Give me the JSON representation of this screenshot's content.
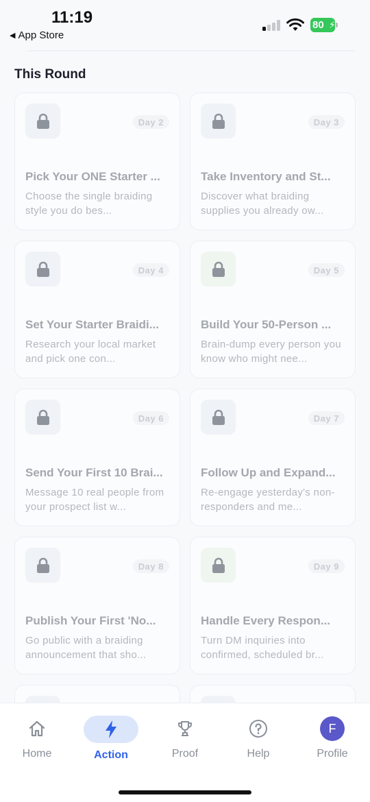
{
  "status_bar": {
    "time": "11:19",
    "back_label": "App Store",
    "battery": "80"
  },
  "section": {
    "title": "This Round"
  },
  "cards": [
    {
      "day": "Day 2",
      "title": "Pick Your ONE Starter ...",
      "desc": "Choose the single braiding style you do bes...",
      "lock_color": "blue"
    },
    {
      "day": "Day 3",
      "title": "Take Inventory and St...",
      "desc": "Discover what braiding supplies you already ow...",
      "lock_color": "blue"
    },
    {
      "day": "Day 4",
      "title": "Set Your Starter Braidi...",
      "desc": "Research your local market and pick one con...",
      "lock_color": "blue"
    },
    {
      "day": "Day 5",
      "title": "Build Your 50-Person ...",
      "desc": "Brain-dump every person you know who might nee...",
      "lock_color": "green"
    },
    {
      "day": "Day 6",
      "title": "Send Your First 10 Brai...",
      "desc": "Message 10 real people from your prospect list w...",
      "lock_color": "blue"
    },
    {
      "day": "Day 7",
      "title": "Follow Up and Expand...",
      "desc": "Re-engage yesterday's non-responders and me...",
      "lock_color": "blue"
    },
    {
      "day": "Day 8",
      "title": "Publish Your First 'No...",
      "desc": "Go public with a braiding announcement that sho...",
      "lock_color": "blue"
    },
    {
      "day": "Day 9",
      "title": "Handle Every Respon...",
      "desc": "Turn DM inquiries into confirmed, scheduled br...",
      "lock_color": "green"
    }
  ],
  "tabs": [
    {
      "label": "Home",
      "icon": "home-icon"
    },
    {
      "label": "Action",
      "icon": "bolt-icon",
      "active": true
    },
    {
      "label": "Proof",
      "icon": "trophy-icon"
    },
    {
      "label": "Help",
      "icon": "help-icon"
    },
    {
      "label": "Profile",
      "icon": "avatar",
      "avatar_letter": "F"
    }
  ],
  "colors": {
    "accent": "#2f62e6",
    "avatar": "#5b58c9",
    "battery": "#34c759"
  }
}
